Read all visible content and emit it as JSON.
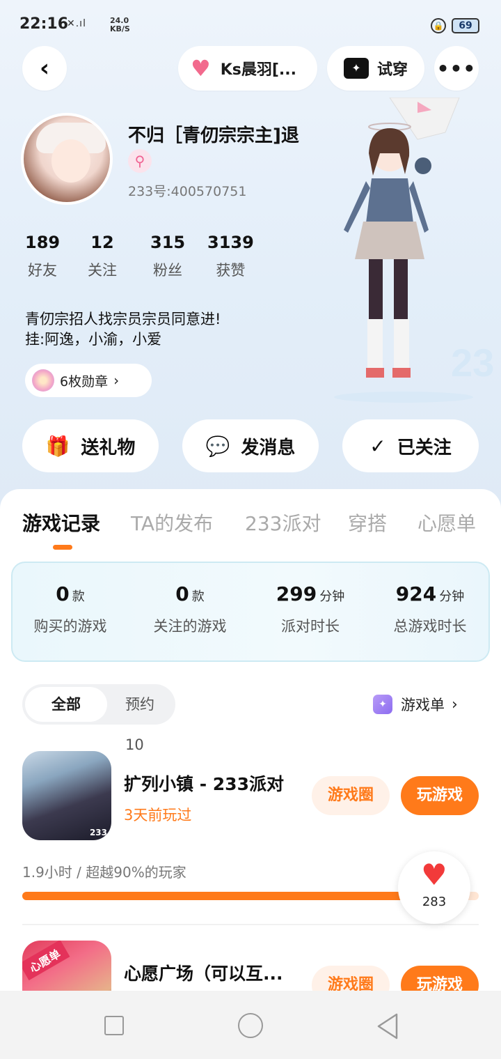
{
  "status": {
    "time": "22:16",
    "signal": "✕.ıl",
    "speed_value": "24.0",
    "speed_unit": "KB/S",
    "battery": "69"
  },
  "header": {
    "back_icon": "‹",
    "friend_name": "Ks晨羽[...",
    "try_on_label": "试穿",
    "more_icon": "•••"
  },
  "profile": {
    "name": "不归［青仞宗宗主]退",
    "gender_icon": "⚲",
    "id": "233号:400570751",
    "stats": [
      {
        "value": "189",
        "label": "好友"
      },
      {
        "value": "12",
        "label": "关注"
      },
      {
        "value": "315",
        "label": "粉丝"
      },
      {
        "value": "3139",
        "label": "获赞"
      }
    ],
    "bio_line1": "青仞宗招人找宗员宗员同意进!",
    "bio_line2": "挂:阿逸，小渝，小爱",
    "medals_label": "6枚勋章"
  },
  "actions": [
    {
      "icon": "🎁",
      "label": "送礼物"
    },
    {
      "icon": "💬",
      "label": "发消息"
    },
    {
      "icon": "✓",
      "label": "已关注"
    }
  ],
  "tabs": [
    "游戏记录",
    "TA的发布",
    "233派对",
    "穿搭",
    "心愿单"
  ],
  "game_stats": [
    {
      "value": "0",
      "unit": "款",
      "label": "购买的游戏"
    },
    {
      "value": "0",
      "unit": "款",
      "label": "关注的游戏"
    },
    {
      "value": "299",
      "unit": "分钟",
      "label": "派对时长"
    },
    {
      "value": "924",
      "unit": "分钟",
      "label": "总游戏时长"
    }
  ],
  "filters": {
    "all": "全部",
    "reserve": "预约 10",
    "game_list": "游戏单"
  },
  "games": [
    {
      "title": "扩列小镇 - 233派对",
      "subtitle": "3天前玩过",
      "circle": "游戏圈",
      "play": "玩游戏",
      "icon_badge": "233",
      "playtime": "1.9小时 / 超越90%的玩家",
      "progress": 0.9
    },
    {
      "title": "心愿广场（可以互...",
      "circle": "游戏圈",
      "play": "玩游戏",
      "icon_tag": "心愿单"
    }
  ],
  "like_count": "283",
  "colors": {
    "accent": "#ff7a1a",
    "heart": "#f23a3a"
  }
}
